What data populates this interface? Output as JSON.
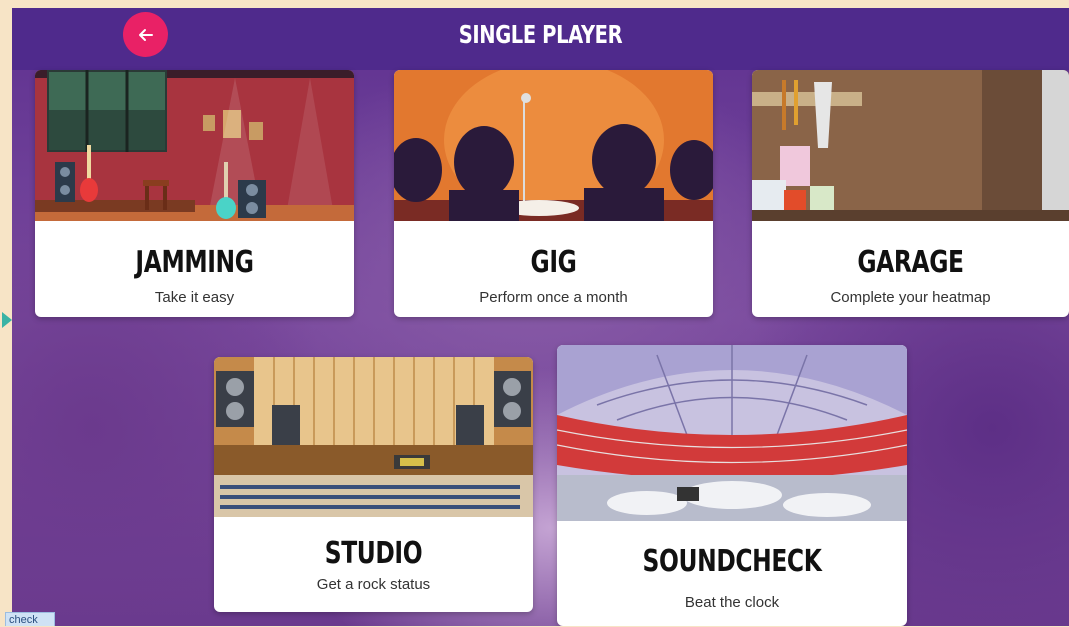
{
  "header": {
    "title": "SINGLE PLAYER",
    "back_icon": "arrow-left-icon",
    "back_color": "#e92166",
    "bar_color": "#4f2a8c"
  },
  "modes": [
    {
      "name": "JAMMING",
      "subtitle": "Take it easy"
    },
    {
      "name": "GIG",
      "subtitle": "Perform once a month"
    },
    {
      "name": "GARAGE",
      "subtitle": "Complete your heatmap"
    },
    {
      "name": "STUDIO",
      "subtitle": "Get a rock status"
    },
    {
      "name": "SOUNDCHECK",
      "subtitle": "Beat the clock"
    }
  ],
  "bottom_tab": {
    "label": "check"
  }
}
